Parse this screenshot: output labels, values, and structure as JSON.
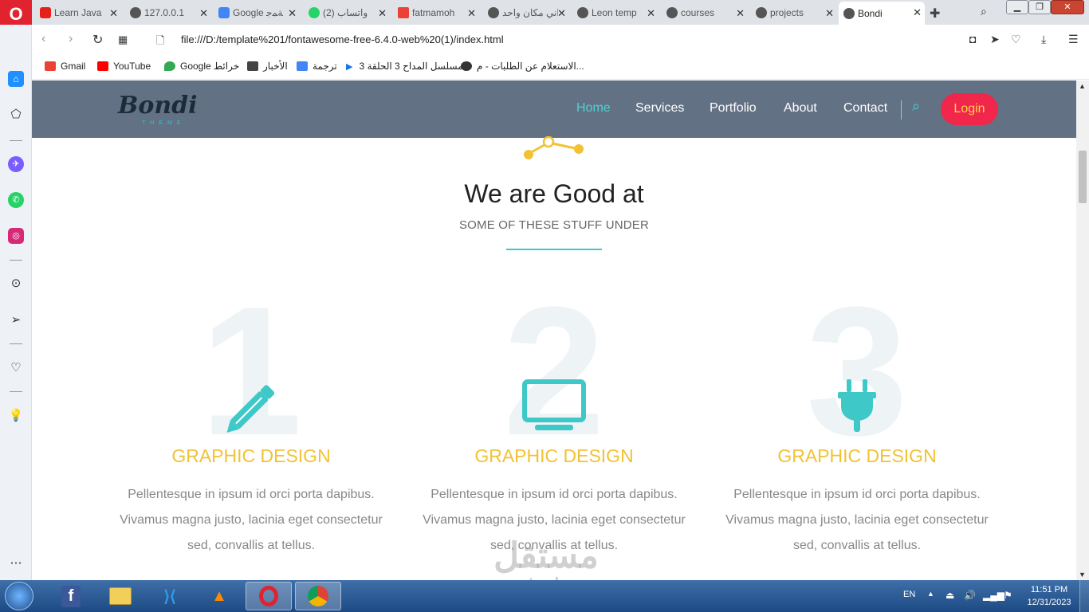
{
  "browser": {
    "tabs": [
      {
        "title": "Learn Java",
        "fav_color": "#e62117"
      },
      {
        "title": "127.0.0.1",
        "fav_color": "#555555"
      },
      {
        "title": "Google ﺔﻤﺟ",
        "fav_color": "#4285f4"
      },
      {
        "title": "(2) واتساب",
        "fav_color": "#25d366"
      },
      {
        "title": "fatmamoh",
        "fav_color": "#ea4335"
      },
      {
        "title": "اني مكان واحد",
        "fav_color": "#555555"
      },
      {
        "title": "Leon temp",
        "fav_color": "#555555"
      },
      {
        "title": "courses",
        "fav_color": "#555555"
      },
      {
        "title": "projects",
        "fav_color": "#555555"
      },
      {
        "title": "Bondi",
        "fav_color": "#555555",
        "active": true
      }
    ],
    "url": "file:///D:/template%201/fontawesome-free-6.4.0-web%20(1)/index.html",
    "bookmarks": [
      {
        "label": "Gmail",
        "color": "#ea4335"
      },
      {
        "label": "YouTube",
        "color": "#ff0000"
      },
      {
        "label": "Google خرائط",
        "color": "#34a853"
      },
      {
        "label": "الأخبار",
        "color": "#444444"
      },
      {
        "label": "ترجمة",
        "color": "#4285f4"
      },
      {
        "label": "مسلسل المداح 3 الحلقة 3...",
        "color": "#1a73e8"
      },
      {
        "label": "الاستعلام عن الطلبات - م...",
        "color": "#333333"
      }
    ]
  },
  "site": {
    "brand": "Bondi",
    "brand_sub": "THEME",
    "nav": [
      "Home",
      "Services",
      "Portfolio",
      "About",
      "Contact"
    ],
    "active_nav": "Home",
    "login": "Login",
    "section_title": "We are Good at",
    "section_subtitle": "SOME OF THESE STUFF UNDER",
    "cards": [
      {
        "number": "1",
        "icon": "pencil-icon",
        "title": "GRAPHIC DESIGN",
        "text": "Pellentesque in ipsum id orci porta dapibus. Vivamus magna justo, lacinia eget consectetur sed, convallis at tellus."
      },
      {
        "number": "2",
        "icon": "desktop-icon",
        "title": "GRAPHIC DESIGN",
        "text": "Pellentesque in ipsum id orci porta dapibus. Vivamus magna justo, lacinia eget consectetur sed, convallis at tellus."
      },
      {
        "number": "3",
        "icon": "plug-icon",
        "title": "GRAPHIC DESIGN",
        "text": "Pellentesque in ipsum id orci porta dapibus. Vivamus magna justo, lacinia eget consectetur sed, convallis at tellus."
      }
    ],
    "colors": {
      "nav_bg": "#637185",
      "accent": "#3ec8c8",
      "title_yellow": "#f2c232",
      "login_bg": "#f0264b"
    }
  },
  "watermark": {
    "arabic": "مستقل",
    "latin": "mostaql.com"
  },
  "taskbar": {
    "lang": "EN",
    "time": "11:51 PM",
    "date": "12/31/2023"
  }
}
